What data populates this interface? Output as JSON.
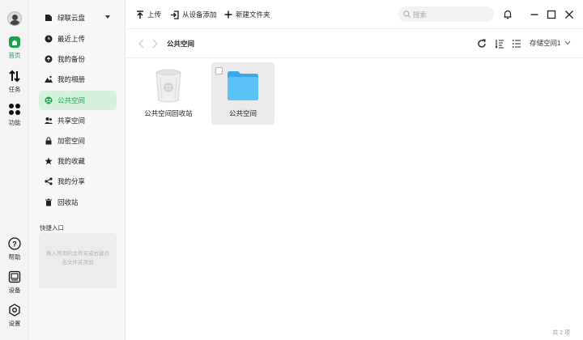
{
  "rail": {
    "items": [
      {
        "label": "首页",
        "icon": "home-icon",
        "active": true
      },
      {
        "label": "任务",
        "icon": "transfer-icon"
      },
      {
        "label": "功能",
        "icon": "apps-icon"
      },
      {
        "label": "帮助",
        "icon": "help-icon"
      },
      {
        "label": "设备",
        "icon": "device-icon"
      },
      {
        "label": "设置",
        "icon": "settings-icon"
      }
    ]
  },
  "sidebar": {
    "items": [
      {
        "label": "绿联云盘",
        "icon": "drive-icon"
      },
      {
        "label": "最近上传",
        "icon": "clock-icon"
      },
      {
        "label": "我的备份",
        "icon": "cloud-icon"
      },
      {
        "label": "我的相册",
        "icon": "photo-icon"
      },
      {
        "label": "公共空间",
        "icon": "shared-space-icon",
        "active": true
      },
      {
        "label": "共享空间",
        "icon": "people-icon"
      },
      {
        "label": "加密空间",
        "icon": "lock-icon"
      },
      {
        "label": "我的收藏",
        "icon": "star-icon"
      },
      {
        "label": "我的分享",
        "icon": "share-icon"
      },
      {
        "label": "回收站",
        "icon": "trash-icon"
      }
    ],
    "quick_access_title": "快捷入口",
    "quick_access_hint": "拖入常用的文件夹或右键点击文件夹添加"
  },
  "toolbar": {
    "upload_label": "上传",
    "add_from_device_label": "从设备添加",
    "new_folder_label": "新建文件夹",
    "search_placeholder": "搜索"
  },
  "pathbar": {
    "current_path": "公共空间",
    "storage_selected": "存储空间1"
  },
  "files": [
    {
      "name": "公共空间回收站",
      "icon": "recycle-bin-icon"
    },
    {
      "name": "公共空间",
      "icon": "folder-icon",
      "selected": true
    }
  ],
  "footer": {
    "count_text": "共 2 项"
  },
  "colors": {
    "accent": "#17a34a",
    "active_bg": "#d6f2dc",
    "folder": "#5bc2f7"
  }
}
